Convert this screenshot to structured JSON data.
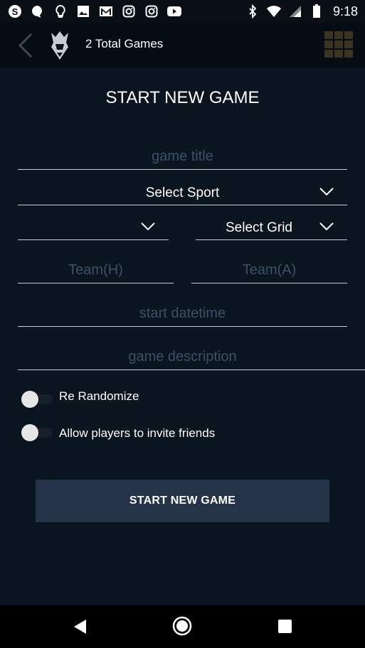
{
  "status_bar": {
    "time": "9:18",
    "left_icons": [
      "skype-icon",
      "chat-bubble-icon",
      "lightbulb-icon",
      "image-icon",
      "gmail-icon",
      "instagram-icon",
      "instagram-icon",
      "youtube-icon"
    ],
    "right_icons": [
      "bluetooth-icon",
      "wifi-icon",
      "signal-icon",
      "battery-icon"
    ]
  },
  "header": {
    "total_games": "2 Total Games",
    "grid_color": "#3b3420"
  },
  "form": {
    "title": "START NEW GAME",
    "game_title_placeholder": "game title",
    "sport_label": "Select Sport",
    "grid_label": "Select Grid",
    "team_home_placeholder": "Team(H)",
    "team_away_placeholder": "Team(A)",
    "start_datetime_placeholder": "start datetime",
    "description_placeholder": "game description",
    "toggle_rerandomize": "Re Randomize",
    "toggle_invite": "Allow players to invite friends",
    "submit_label": "START NEW GAME"
  },
  "colors": {
    "background": "#0b1520",
    "button": "#243347",
    "placeholder": "#3d5068"
  }
}
